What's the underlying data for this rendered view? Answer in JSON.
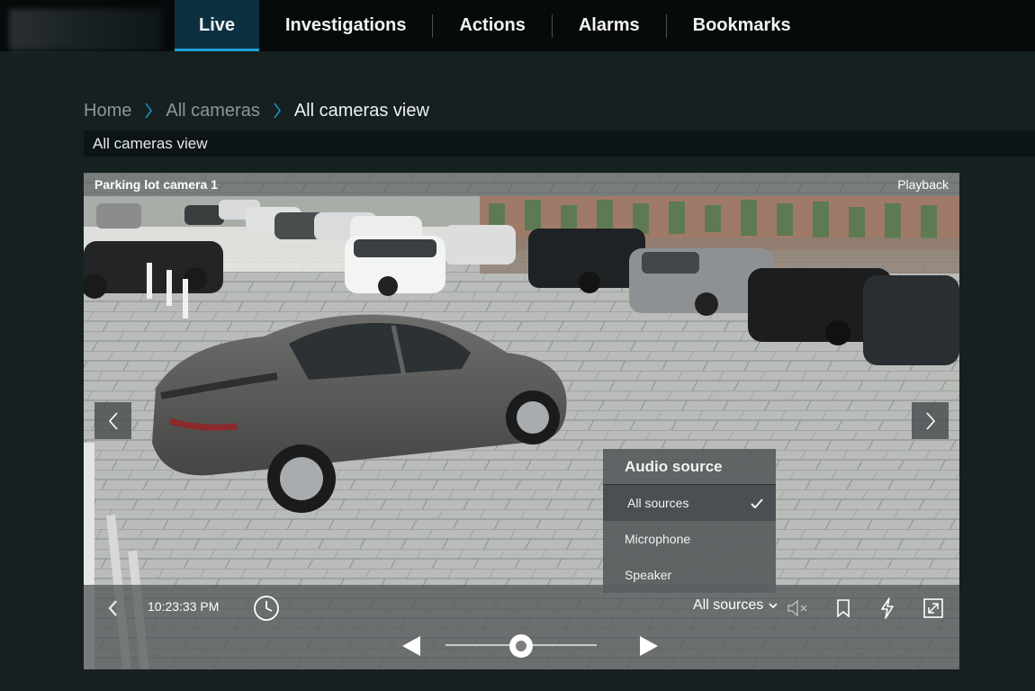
{
  "nav": {
    "tabs": [
      {
        "label": "Live",
        "active": true
      },
      {
        "label": "Investigations",
        "active": false
      },
      {
        "label": "Actions",
        "active": false
      },
      {
        "label": "Alarms",
        "active": false
      },
      {
        "label": "Bookmarks",
        "active": false
      }
    ]
  },
  "breadcrumb": {
    "items": [
      "Home",
      "All cameras",
      "All cameras view"
    ]
  },
  "view": {
    "title": "All cameras view"
  },
  "camera": {
    "name": "Parking lot camera 1",
    "mode_label": "Playback"
  },
  "audio_menu": {
    "title": "Audio source",
    "items": [
      {
        "label": "All sources",
        "selected": true
      },
      {
        "label": "Microphone",
        "selected": false
      },
      {
        "label": "Speaker",
        "selected": false
      }
    ]
  },
  "controls": {
    "time": "10:23:33 PM",
    "audio_source_selected": "All sources",
    "playback_position": 0.5
  },
  "icons": {
    "prev_camera": "chevron-left-icon",
    "next_camera": "chevron-right-icon",
    "back": "chevron-left-icon",
    "clock": "clock-icon",
    "mute": "speaker-muted-icon",
    "bookmark": "bookmark-icon",
    "event": "lightning-icon",
    "fullscreen": "maximize-icon",
    "step_back": "triangle-left-icon",
    "step_forward": "triangle-right-icon",
    "check": "checkmark-icon",
    "dropdown": "chevron-down-icon"
  },
  "colors": {
    "accent": "#1e9fd5",
    "active_tab_bg": "#0c3042",
    "topbar_bg": "#070a0a",
    "page_bg": "#172020"
  }
}
